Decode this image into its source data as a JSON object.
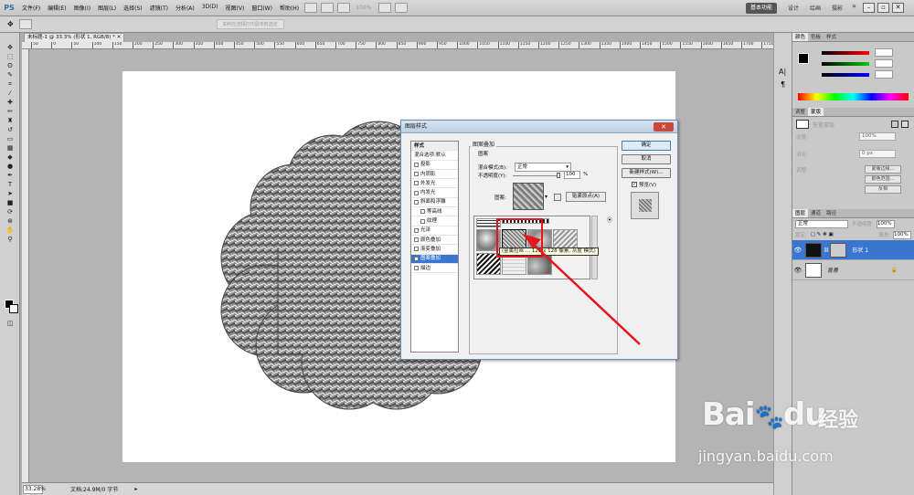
{
  "app": {
    "logo": "PS"
  },
  "menu": [
    "文件(F)",
    "编辑(E)",
    "图像(I)",
    "图层(L)",
    "选择(S)",
    "滤镜(T)",
    "分析(A)",
    "3D(D)",
    "视图(V)",
    "窗口(W)",
    "帮助(H)"
  ],
  "menubar_extra": {
    "zoom": "100%",
    "workspace": "基本功能",
    "tabs": [
      "设计",
      "绘画",
      "摄影"
    ],
    "more": "»"
  },
  "options": {
    "hint": "如何在选择打印副本时选定"
  },
  "document": {
    "tab": "未标题-1 @ 33.3% (形状 1, RGB/8) *",
    "zoom": "33.28%",
    "info": "文档:24.9M/0 字节"
  },
  "ruler_ticks": [
    "50",
    "0",
    "50",
    "100",
    "150",
    "200",
    "250",
    "300",
    "350",
    "400",
    "450",
    "500",
    "550",
    "600",
    "650",
    "700",
    "750",
    "800",
    "850",
    "900",
    "950",
    "1000",
    "1050",
    "1100",
    "1150",
    "1200",
    "1250",
    "1300",
    "1350",
    "1400",
    "1450",
    "1500",
    "1550",
    "1600",
    "1650",
    "1700",
    "1750"
  ],
  "panels": {
    "color_tabs": [
      "颜色",
      "色板",
      "样式"
    ],
    "adjust_tabs": [
      "调整",
      "蒙版"
    ],
    "mask_label": "矢量蒙版",
    "props": [
      {
        "label": "浓度:",
        "value": "100%"
      },
      {
        "label": "羽化:",
        "value": "0 px"
      },
      {
        "label": "调整:",
        "button": "蒙版边缘..."
      },
      {
        "label": "",
        "button": "颜色范围..."
      },
      {
        "label": "",
        "button": "反相"
      }
    ],
    "layer_tabs": [
      "图层",
      "通道",
      "路径"
    ],
    "blend": "正常",
    "opacity_label": "不透明度:",
    "opacity": "100%",
    "lock_label": "锁定:",
    "fill_label": "填充:",
    "fill": "100%",
    "layers": [
      {
        "name": "形状 1",
        "active": true
      },
      {
        "name": "背景",
        "active": false
      }
    ]
  },
  "dialog": {
    "title": "图层样式",
    "close": "✕",
    "styles_header": "样式",
    "styles": [
      {
        "label": "混合选项:默认",
        "checkbox": false,
        "indent": false,
        "active": false
      },
      {
        "label": "投影",
        "checkbox": true,
        "indent": false,
        "active": false
      },
      {
        "label": "内阴影",
        "checkbox": true,
        "indent": false,
        "active": false
      },
      {
        "label": "外发光",
        "checkbox": true,
        "indent": false,
        "active": false
      },
      {
        "label": "内发光",
        "checkbox": true,
        "indent": false,
        "active": false
      },
      {
        "label": "斜面和浮雕",
        "checkbox": true,
        "indent": false,
        "active": false
      },
      {
        "label": "等高线",
        "checkbox": true,
        "indent": true,
        "active": false
      },
      {
        "label": "纹理",
        "checkbox": true,
        "indent": true,
        "active": false
      },
      {
        "label": "光泽",
        "checkbox": true,
        "indent": false,
        "active": false
      },
      {
        "label": "颜色叠加",
        "checkbox": true,
        "indent": false,
        "active": false
      },
      {
        "label": "渐变叠加",
        "checkbox": true,
        "indent": false,
        "active": false
      },
      {
        "label": "图案叠加",
        "checkbox": true,
        "indent": false,
        "active": true
      },
      {
        "label": "描边",
        "checkbox": true,
        "indent": false,
        "active": false
      }
    ],
    "group_title": "图案叠加",
    "sub_title": "图案",
    "blend_label": "混合模式(B):",
    "blend_value": "正常",
    "opacity_label": "不透明度(Y):",
    "opacity_value": "100",
    "opacity_unit": "%",
    "pattern_label": "图案:",
    "snap_button": "贴紧原点(A)",
    "tooltip": "(金属拉丝 ... 128 x 128 像素, 灰度 模式)",
    "buttons": [
      "确定",
      "取消",
      "新建样式(W)..."
    ],
    "preview_label": "预览(V)"
  },
  "watermark": {
    "brand": "Bai",
    "brand_tail": "du",
    "cn": "经验",
    "url": "jingyan.baidu.com"
  },
  "colors": {
    "accent": "#3a76d0",
    "arrow": "#e8141c"
  }
}
